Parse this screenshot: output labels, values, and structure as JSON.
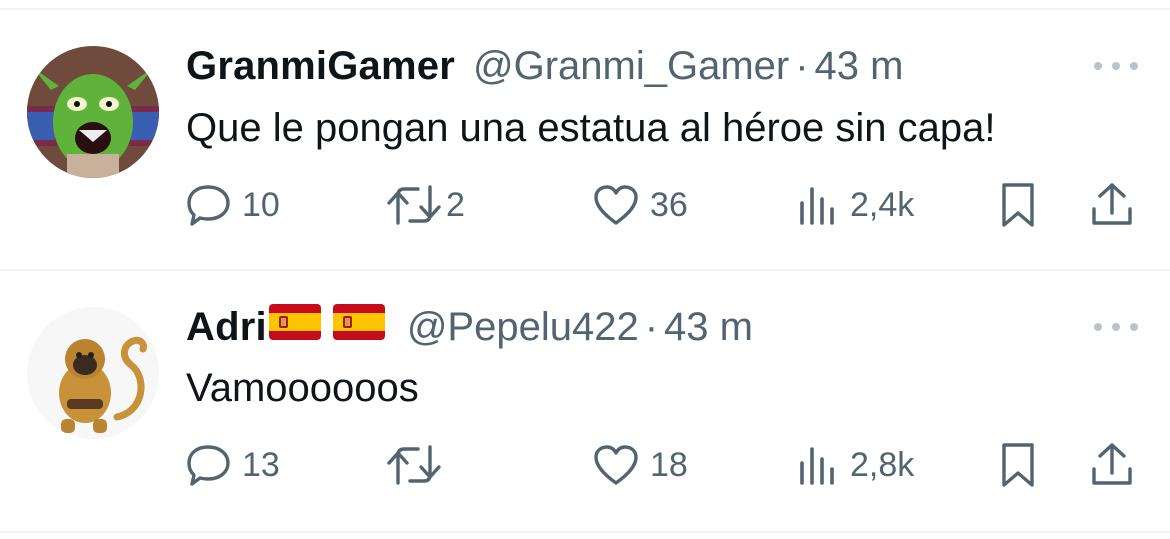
{
  "tweets": [
    {
      "name": "GranmiGamer",
      "handle": "@Granmi_Gamer",
      "dot": "·",
      "time": "43 m",
      "text": "Que le pongan una estatua al héroe sin capa!",
      "avatar_icon": "green-goblin-avatar",
      "flags": [],
      "replies": "10",
      "retweets": "2",
      "likes": "36",
      "views": "2,4k"
    },
    {
      "name": "Adri",
      "handle": "@Pepelu422",
      "dot": "·",
      "time": "43 m",
      "text": "Vamoooooos",
      "avatar_icon": "monkey-avatar",
      "flags": [
        "spain-flag",
        "spain-flag"
      ],
      "replies": "13",
      "retweets": "",
      "likes": "18",
      "views": "2,8k"
    }
  ],
  "colors": {
    "text_primary": "#0f1419",
    "text_secondary": "#536471",
    "divider": "#eff3f4",
    "flag_red": "#c60b1e",
    "flag_yellow": "#ffc400"
  }
}
